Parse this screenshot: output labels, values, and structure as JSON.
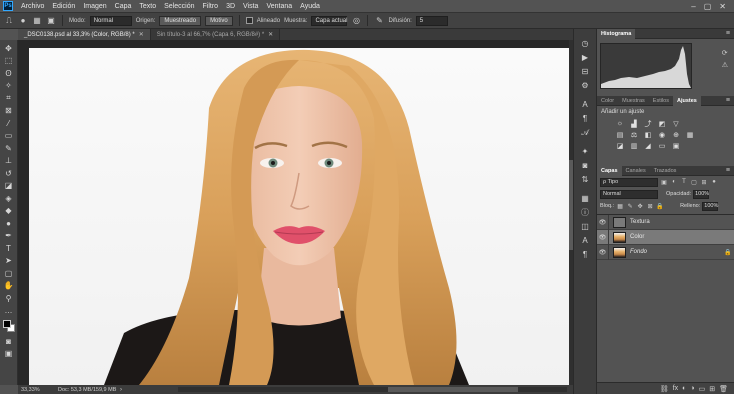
{
  "menubar": {
    "logo": "Ps",
    "items": [
      "Archivo",
      "Edición",
      "Imagen",
      "Capa",
      "Texto",
      "Selección",
      "Filtro",
      "3D",
      "Vista",
      "Ventana",
      "Ayuda"
    ],
    "window_controls": [
      "–",
      "▢",
      "✕"
    ]
  },
  "options": {
    "mode_label": "Modo:",
    "mode_value": "Normal",
    "origin_label": "Origen:",
    "sampled": "Muestreado",
    "pattern": "Motivo",
    "aligned_label": "Alineado",
    "sample_label": "Muestra:",
    "sample_value": "Capa actual",
    "diffusion_label": "Difusión:",
    "diffusion_value": "5"
  },
  "tabs": [
    {
      "label": "_DSC0138.psd al 33,3% (Color, RGB/8) *",
      "active": true
    },
    {
      "label": "Sin título-3 al 66,7% (Capa 6, RGB/8#) *",
      "active": false
    }
  ],
  "status": {
    "zoom": "33,33%",
    "doc": "Doc: 53,3 MB/159,9 MB",
    "arrow": "›"
  },
  "histogram": {
    "tab": "Histograma"
  },
  "adjustments": {
    "tabs": [
      "Color",
      "Muestras",
      "Estilos",
      "Ajustes"
    ],
    "active_tab": "Ajustes",
    "title": "Añadir un ajuste"
  },
  "layers_panel": {
    "tabs": [
      "Capas",
      "Canales",
      "Trazados"
    ],
    "active_tab": "Capas",
    "filter": "ρ Tipo",
    "blend_mode": "Normal",
    "opacity_label": "Opacidad:",
    "opacity_value": "100%",
    "lock_label": "Bloq.:",
    "fill_label": "Relleno:",
    "fill_value": "100%",
    "layers": [
      {
        "name": "Textura",
        "thumb": "gray",
        "selected": false,
        "locked": false
      },
      {
        "name": "Color",
        "thumb": "photo",
        "selected": true,
        "locked": false
      },
      {
        "name": "Fondo",
        "thumb": "photo",
        "selected": false,
        "locked": true
      }
    ],
    "bottom_icons": [
      "⛓",
      "fx",
      "◐",
      "◑",
      "▭",
      "⊞",
      "🗑"
    ]
  },
  "colors": {
    "accent": "#31a8ff",
    "hair": "#d9a05a",
    "skin": "#f0c6ad",
    "lips": "#e0506a",
    "eyes": "#6f8a7c",
    "clothing": "#1c1817"
  }
}
